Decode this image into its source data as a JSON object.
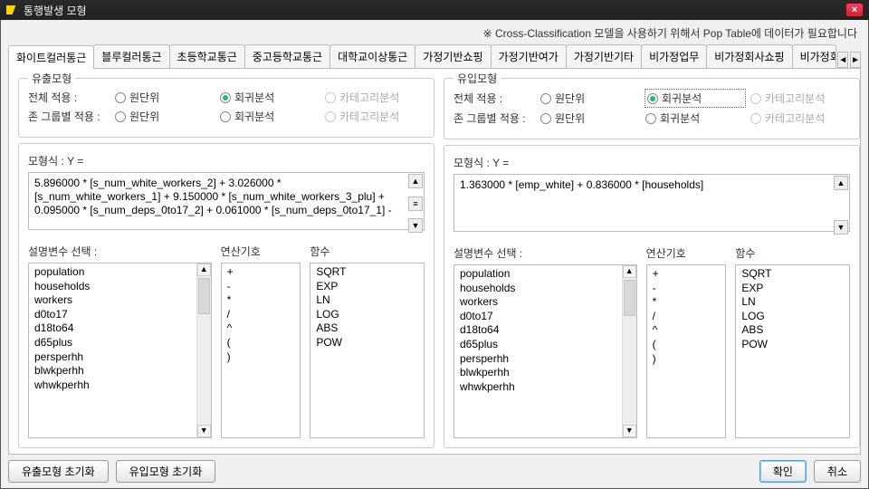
{
  "window": {
    "title": "통행발생 모형",
    "close": "×"
  },
  "notice": "※ Cross-Classification 모델을 사용하기 위해서 Pop Table에 데이터가 필요합니다",
  "tabs": [
    "화이트컬러통근",
    "블루컬러통근",
    "초등학교통근",
    "중고등학교통근",
    "대학교이상통근",
    "가정기반쇼핑",
    "가정기반여가",
    "가정기반기타",
    "비가정업무",
    "비가정회사쇼핑",
    "비가정회사기타"
  ],
  "tabscroll": {
    "left": "◄",
    "right": "►"
  },
  "left": {
    "legend": "유출모형",
    "row1_label": "전체 적용 :",
    "row2_label": "존 그룹별 적용 :",
    "opts": {
      "unit": "원단위",
      "reg": "회귀분석",
      "cat": "카테고리분석"
    },
    "eq_label": "모형식 : Y =",
    "equation": "5.896000 * [s_num_white_workers_2] + 3.026000 * [s_num_white_workers_1] + 9.150000 * [s_num_white_workers_3_plu] + 0.095000 * [s_num_deps_0to17_2] + 0.061000 * [s_num_deps_0to17_1] -",
    "vars_label": "설명변수 선택 :",
    "ops_label": "연산기호",
    "func_label": "함수",
    "vars": [
      "population",
      "households",
      "workers",
      "d0to17",
      "d18to64",
      "d65plus",
      "persperhh",
      "blwkperhh",
      "whwkperhh"
    ],
    "ops": [
      "+",
      "-",
      "*",
      "/",
      "^",
      "(",
      ")"
    ],
    "funcs": [
      "SQRT",
      "EXP",
      "LN",
      "LOG",
      "ABS",
      "POW"
    ]
  },
  "right": {
    "legend": "유입모형",
    "row1_label": "전체 적용 :",
    "row2_label": "존 그룹별 적용 :",
    "opts": {
      "unit": "원단위",
      "reg": "회귀분석",
      "cat": "카테고리분석"
    },
    "eq_label": "모형식 : Y =",
    "equation": "1.363000 * [emp_white] + 0.836000 * [households]",
    "vars_label": "설명변수 선택 :",
    "ops_label": "연산기호",
    "func_label": "함수",
    "vars": [
      "population",
      "households",
      "workers",
      "d0to17",
      "d18to64",
      "d65plus",
      "persperhh",
      "blwkperhh",
      "whwkperhh"
    ],
    "ops": [
      "+",
      "-",
      "*",
      "/",
      "^",
      "(",
      ")"
    ],
    "funcs": [
      "SQRT",
      "EXP",
      "LN",
      "LOG",
      "ABS",
      "POW"
    ]
  },
  "footer": {
    "reset_out": "유출모형 초기화",
    "reset_in": "유입모형 초기화",
    "ok": "확인",
    "cancel": "취소"
  },
  "scroll": {
    "up": "▲",
    "down": "▼",
    "lines": "≡"
  }
}
